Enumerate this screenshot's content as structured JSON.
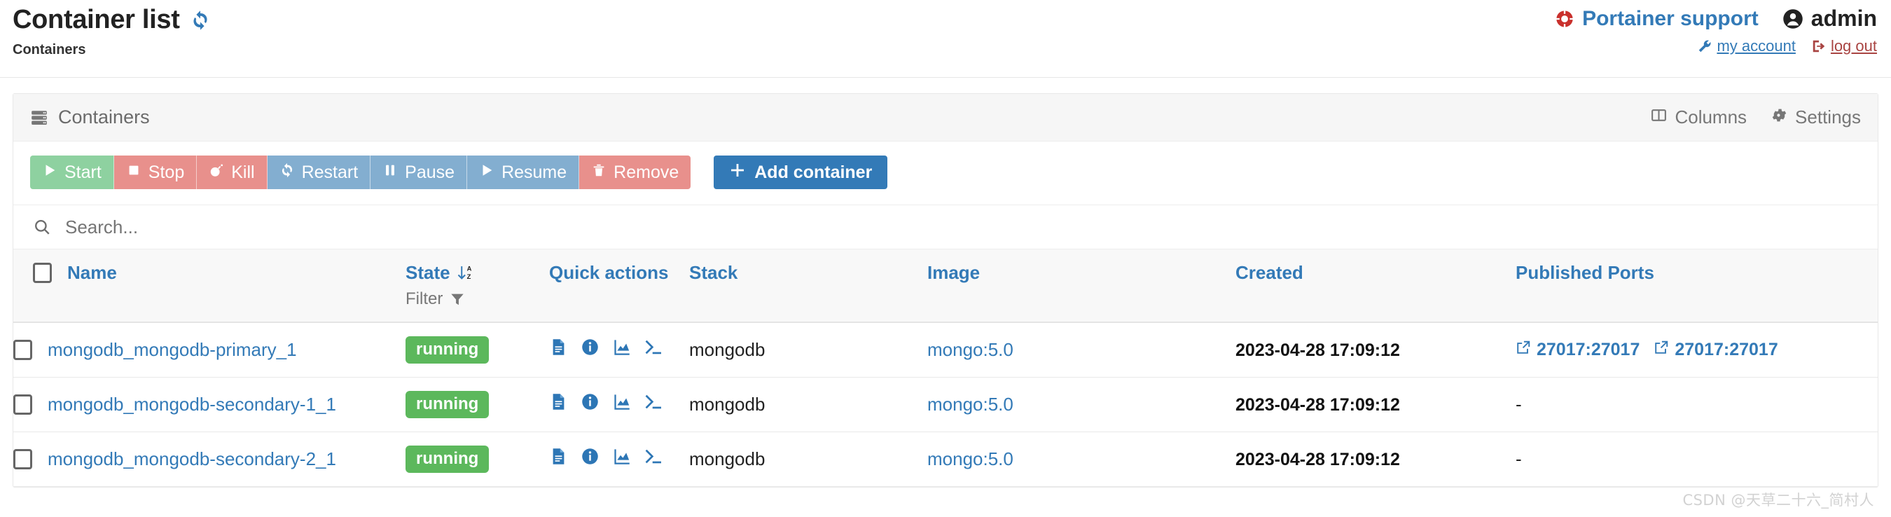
{
  "header": {
    "title": "Container list",
    "refresh_icon": "refresh-icon",
    "breadcrumb": "Containers",
    "support_label": "Portainer support",
    "support_icon": "lifering-icon",
    "user_name": "admin",
    "user_icon": "user-circle-icon",
    "my_account_label": "my account",
    "my_account_icon": "wrench-icon",
    "logout_label": "log out",
    "logout_icon": "sign-out-icon"
  },
  "card": {
    "title": "Containers",
    "title_icon": "server-stack-icon",
    "columns_label": "Columns",
    "columns_icon": "columns-icon",
    "settings_label": "Settings",
    "settings_icon": "gear-icon"
  },
  "toolbar": {
    "buttons": [
      {
        "label": "Start",
        "icon": "play-icon",
        "color": "#8ed1a0"
      },
      {
        "label": "Stop",
        "icon": "stop-icon",
        "color": "#e8908c"
      },
      {
        "label": "Kill",
        "icon": "bomb-icon",
        "color": "#e8908c"
      },
      {
        "label": "Restart",
        "icon": "restart-icon",
        "color": "#83aed0"
      },
      {
        "label": "Pause",
        "icon": "pause-icon",
        "color": "#83aed0"
      },
      {
        "label": "Resume",
        "icon": "play-icon",
        "color": "#83aed0"
      },
      {
        "label": "Remove",
        "icon": "trash-icon",
        "color": "#e8908c"
      }
    ],
    "add_label": "Add container",
    "add_icon": "plus-icon"
  },
  "search": {
    "placeholder": "Search...",
    "value": "",
    "icon": "search-icon"
  },
  "table": {
    "columns": {
      "name": "Name",
      "state": "State",
      "state_filter": "Filter",
      "quick_actions": "Quick actions",
      "stack": "Stack",
      "image": "Image",
      "created": "Created",
      "ports": "Published Ports"
    },
    "sort_icon": "sort-alpha-down-icon",
    "filter_icon": "funnel-icon",
    "quick_action_icons": [
      "logs-icon",
      "inspect-icon",
      "stats-icon",
      "console-icon"
    ],
    "rows": [
      {
        "name": "mongodb_mongodb-primary_1",
        "state": "running",
        "stack": "mongodb",
        "image": "mongo:5.0",
        "created": "2023-04-28 17:09:12",
        "ports": [
          "27017:27017",
          "27017:27017"
        ]
      },
      {
        "name": "mongodb_mongodb-secondary-1_1",
        "state": "running",
        "stack": "mongodb",
        "image": "mongo:5.0",
        "created": "2023-04-28 17:09:12",
        "ports": [
          "-"
        ]
      },
      {
        "name": "mongodb_mongodb-secondary-2_1",
        "state": "running",
        "stack": "mongodb",
        "image": "mongo:5.0",
        "created": "2023-04-28 17:09:12",
        "ports": [
          "-"
        ]
      }
    ]
  },
  "watermark": "CSDN @天草二十六_简村人",
  "colors": {
    "link": "#337ab7",
    "running_badge": "#5cb85c",
    "danger": "#a94442",
    "primary_button": "#337ab7"
  }
}
